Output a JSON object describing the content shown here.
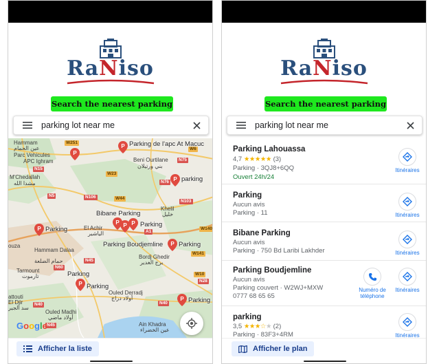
{
  "app": {
    "brand": {
      "name_part1": "Ra",
      "name_part2": "N",
      "name_part3": "iso"
    },
    "cta_label": "Search the nearest parking"
  },
  "search": {
    "query": "parking lot near me"
  },
  "map_screen": {
    "place_labels": [
      "Hammam",
      "عين الحمام",
      "Parc Vehicules",
      "APC Ighram",
      "M'Chedallah",
      "مشدا الله",
      "Beni Ourtilane",
      "بني ورتيلان",
      "El Achir",
      "الياشير",
      "Bordj Ghedir",
      "برج الغدير",
      "Hammam Dalaa",
      "حمام الضلعة",
      "Tarmount",
      "تارموت",
      "Ouled Derradj",
      "أولاد دراج",
      "Ouled Madhi",
      "أولاد ماضي",
      "Ain Khadra",
      "عين الخضراء",
      "Khelil",
      "خليل",
      "ouza",
      "attouti",
      "El Djir",
      "سد الجير"
    ],
    "parking_labels": [
      "Parking de l'apc At Macuc",
      "parking",
      "Bibane Parking",
      "Parking",
      "Parking",
      "Parking Boudjemline",
      "Parking",
      "Parking",
      "Parking",
      "Parking"
    ],
    "road_labels": [
      "W251",
      "W6",
      "N15",
      "N75",
      "W23",
      "N76",
      "N5",
      "N106",
      "W44",
      "N103",
      "A1",
      "W140",
      "N45",
      "W141",
      "N60",
      "W10",
      "N28",
      "N40",
      "N40",
      "N45"
    ],
    "google_logo": "Google",
    "list_button": "Afficher la liste"
  },
  "list_screen": {
    "results": [
      {
        "name": "Parking Lahouassa",
        "rating": "4,7",
        "stars_filled": 5,
        "reviews": "(3)",
        "details": "Parking · 3QJ8+6QQ",
        "status": "Ouvert 24h/24",
        "directions": "Itinéraires"
      },
      {
        "name": "Parking",
        "rating_text": "Aucun avis",
        "details": "Parking · 11",
        "directions": "Itinéraires"
      },
      {
        "name": "Bibane Parking",
        "rating_text": "Aucun avis",
        "details": "Parking · 750 Bd Laribi Lakhder",
        "directions": "Itinéraires"
      },
      {
        "name": "Parking Boudjemline",
        "rating_text": "Aucun avis",
        "details": "Parking couvert · W2WJ+MXW",
        "phone": "0777 68 65 65",
        "call_label_1": "Numéro de",
        "call_label_2": "téléphone",
        "directions": "Itinéraires"
      },
      {
        "name": "parking",
        "rating": "3,5",
        "stars_filled": 3.5,
        "reviews": "(2)",
        "details": "Parking · 83F3+4RM",
        "directions": "Itinéraires"
      }
    ],
    "map_button": "Afficher le plan"
  },
  "colors": {
    "brand_blue": "#2a4f7c",
    "brand_red": "#c4252b",
    "cta_green": "#1ee81e",
    "link_blue": "#1a73e8",
    "pin_red": "#e04a3f"
  }
}
